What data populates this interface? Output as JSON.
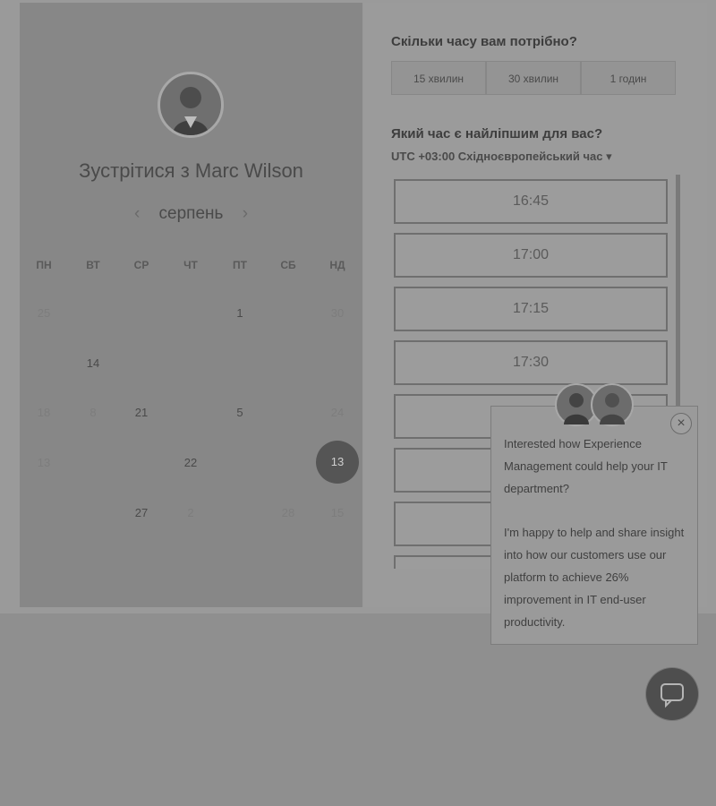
{
  "host": {
    "title": "Зустрітися з Marc Wilson",
    "avatar_icon": "person-photo"
  },
  "calendar": {
    "month": "серпень",
    "prev_icon": "chevron-left-icon",
    "next_icon": "chevron-right-icon",
    "days_of_week": [
      "ПН",
      "ВТ",
      "СР",
      "ЧТ",
      "ПТ",
      "СБ",
      "НД"
    ],
    "rows": [
      [
        "25",
        "",
        "",
        "",
        "1",
        "",
        "30"
      ],
      [
        "",
        "14",
        "",
        "",
        "",
        "",
        ""
      ],
      [
        "18",
        "8",
        "21",
        "",
        "5",
        "",
        "24"
      ],
      [
        "13",
        "",
        "",
        "22",
        "",
        "",
        "13"
      ],
      [
        "",
        "",
        "27",
        "2",
        "",
        "28",
        "15"
      ]
    ],
    "selected_day": "13"
  },
  "duration": {
    "question": "Скільки часу вам потрібно?",
    "options": [
      "15 хвилин",
      "30 хвилин",
      "1 годин"
    ]
  },
  "time": {
    "question": "Який час є найліпшим для вас?",
    "timezone": "UTC +03:00 Східноєвропейський час",
    "slots": [
      "16:45",
      "17:00",
      "17:15",
      "17:30",
      "",
      "",
      "",
      ""
    ]
  },
  "popup": {
    "close_label": "×",
    "message_1": "Interested how Experience Management could help your IT department?",
    "message_2": "I'm happy to help and share insight into how our customers use our platform to achieve 26% improvement in IT end-user productivity."
  },
  "chat": {
    "icon": "chat-bubble-icon"
  }
}
